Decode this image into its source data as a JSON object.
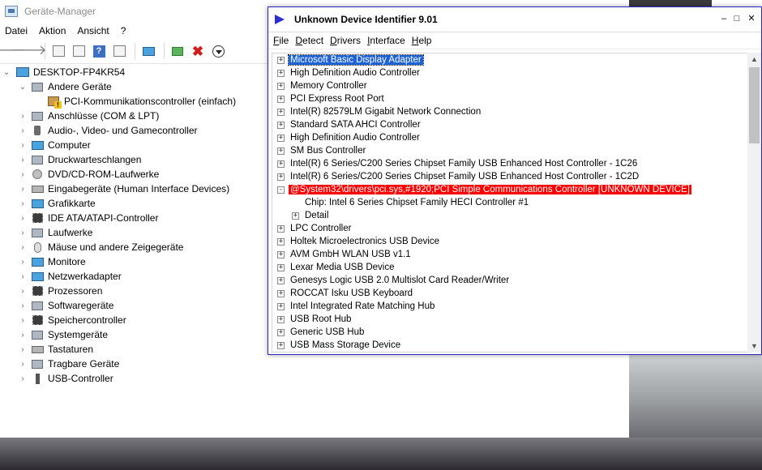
{
  "device_manager": {
    "title": "Geräte-Manager",
    "menu": [
      "Datei",
      "Aktion",
      "Ansicht",
      "?"
    ],
    "toolbar_icons": [
      "back-arrow-icon",
      "forward-arrow-icon",
      "properties-icon",
      "device-view-icon",
      "help-icon",
      "view-icon",
      "monitor-icon",
      "update-driver-icon",
      "uninstall-icon",
      "download-icon"
    ],
    "computer_name": "DESKTOP-FP4KR54",
    "tree": [
      {
        "label": "Andere Geräte",
        "expanded": true,
        "icon": "other-devices-icon"
      },
      {
        "label": "PCI-Kommunikationscontroller (einfach)",
        "child": true,
        "icon": "warning-device-icon"
      },
      {
        "label": "Anschlüsse (COM & LPT)",
        "icon": "port-icon"
      },
      {
        "label": "Audio-, Video- und Gamecontroller",
        "icon": "speaker-icon"
      },
      {
        "label": "Computer",
        "icon": "computer-icon"
      },
      {
        "label": "Druckwarteschlangen",
        "icon": "printer-icon"
      },
      {
        "label": "DVD/CD-ROM-Laufwerke",
        "icon": "disk-icon"
      },
      {
        "label": "Eingabegeräte (Human Interface Devices)",
        "icon": "hid-icon"
      },
      {
        "label": "Grafikkarte",
        "icon": "display-adapter-icon"
      },
      {
        "label": "IDE ATA/ATAPI-Controller",
        "icon": "ide-icon"
      },
      {
        "label": "Laufwerke",
        "icon": "drive-icon"
      },
      {
        "label": "Mäuse und andere Zeigegeräte",
        "icon": "mouse-icon"
      },
      {
        "label": "Monitore",
        "icon": "monitor-icon"
      },
      {
        "label": "Netzwerkadapter",
        "icon": "network-icon"
      },
      {
        "label": "Prozessoren",
        "icon": "processor-icon"
      },
      {
        "label": "Softwaregeräte",
        "icon": "software-device-icon"
      },
      {
        "label": "Speichercontroller",
        "icon": "storage-icon"
      },
      {
        "label": "Systemgeräte",
        "icon": "system-icon"
      },
      {
        "label": "Tastaturen",
        "icon": "keyboard-icon"
      },
      {
        "label": "Tragbare Geräte",
        "icon": "portable-icon"
      },
      {
        "label": "USB-Controller",
        "icon": "usb-icon"
      }
    ]
  },
  "udi": {
    "title": "Unknown Device Identifier 9.01",
    "menu": [
      {
        "first": "F",
        "rest": "ile"
      },
      {
        "first": "D",
        "rest": "etect"
      },
      {
        "first": "D",
        "rest": "rivers"
      },
      {
        "first": "I",
        "rest": "nterface"
      },
      {
        "first": "H",
        "rest": "elp"
      }
    ],
    "rows": [
      {
        "label": "Microsoft Basic Display Adapter",
        "state": "selected"
      },
      {
        "label": "High Definition Audio Controller"
      },
      {
        "label": "Memory Controller"
      },
      {
        "label": "PCI Express Root Port"
      },
      {
        "label": "Intel(R) 82579LM Gigabit Network Connection"
      },
      {
        "label": "Standard SATA AHCI Controller"
      },
      {
        "label": "High Definition Audio Controller"
      },
      {
        "label": "SM Bus Controller"
      },
      {
        "label": "Intel(R) 6 Series/C200 Series Chipset Family USB Enhanced Host Controller - 1C26"
      },
      {
        "label": "Intel(R) 6 Series/C200 Series Chipset Family USB Enhanced Host Controller - 1C2D"
      },
      {
        "label": "@System32\\drivers\\pci.sys,#1920;PCI Simple Communications Controller [UNKNOWN DEVICE]",
        "state": "unknown",
        "expanded": true
      },
      {
        "label": "Chip: Intel  6 Series Chipset Family HECI Controller #1",
        "level": 1,
        "leaf": true
      },
      {
        "label": "Detail",
        "level": 1
      },
      {
        "label": "LPC Controller"
      },
      {
        "label": "Holtek Microelectronics USB Device"
      },
      {
        "label": "AVM GmbH WLAN USB v1.1"
      },
      {
        "label": "Lexar Media USB Device"
      },
      {
        "label": "Genesys Logic USB 2.0 Multislot Card Reader/Writer"
      },
      {
        "label": "ROCCAT Isku USB Keyboard"
      },
      {
        "label": "Intel Integrated Rate Matching Hub"
      },
      {
        "label": "USB Root Hub"
      },
      {
        "label": "Generic USB Hub"
      },
      {
        "label": "USB Mass Storage Device"
      }
    ]
  },
  "colors": {
    "selection_blue": "#1e63d6",
    "unknown_red": "#ff0000",
    "udi_border": "#2a2ac0"
  }
}
